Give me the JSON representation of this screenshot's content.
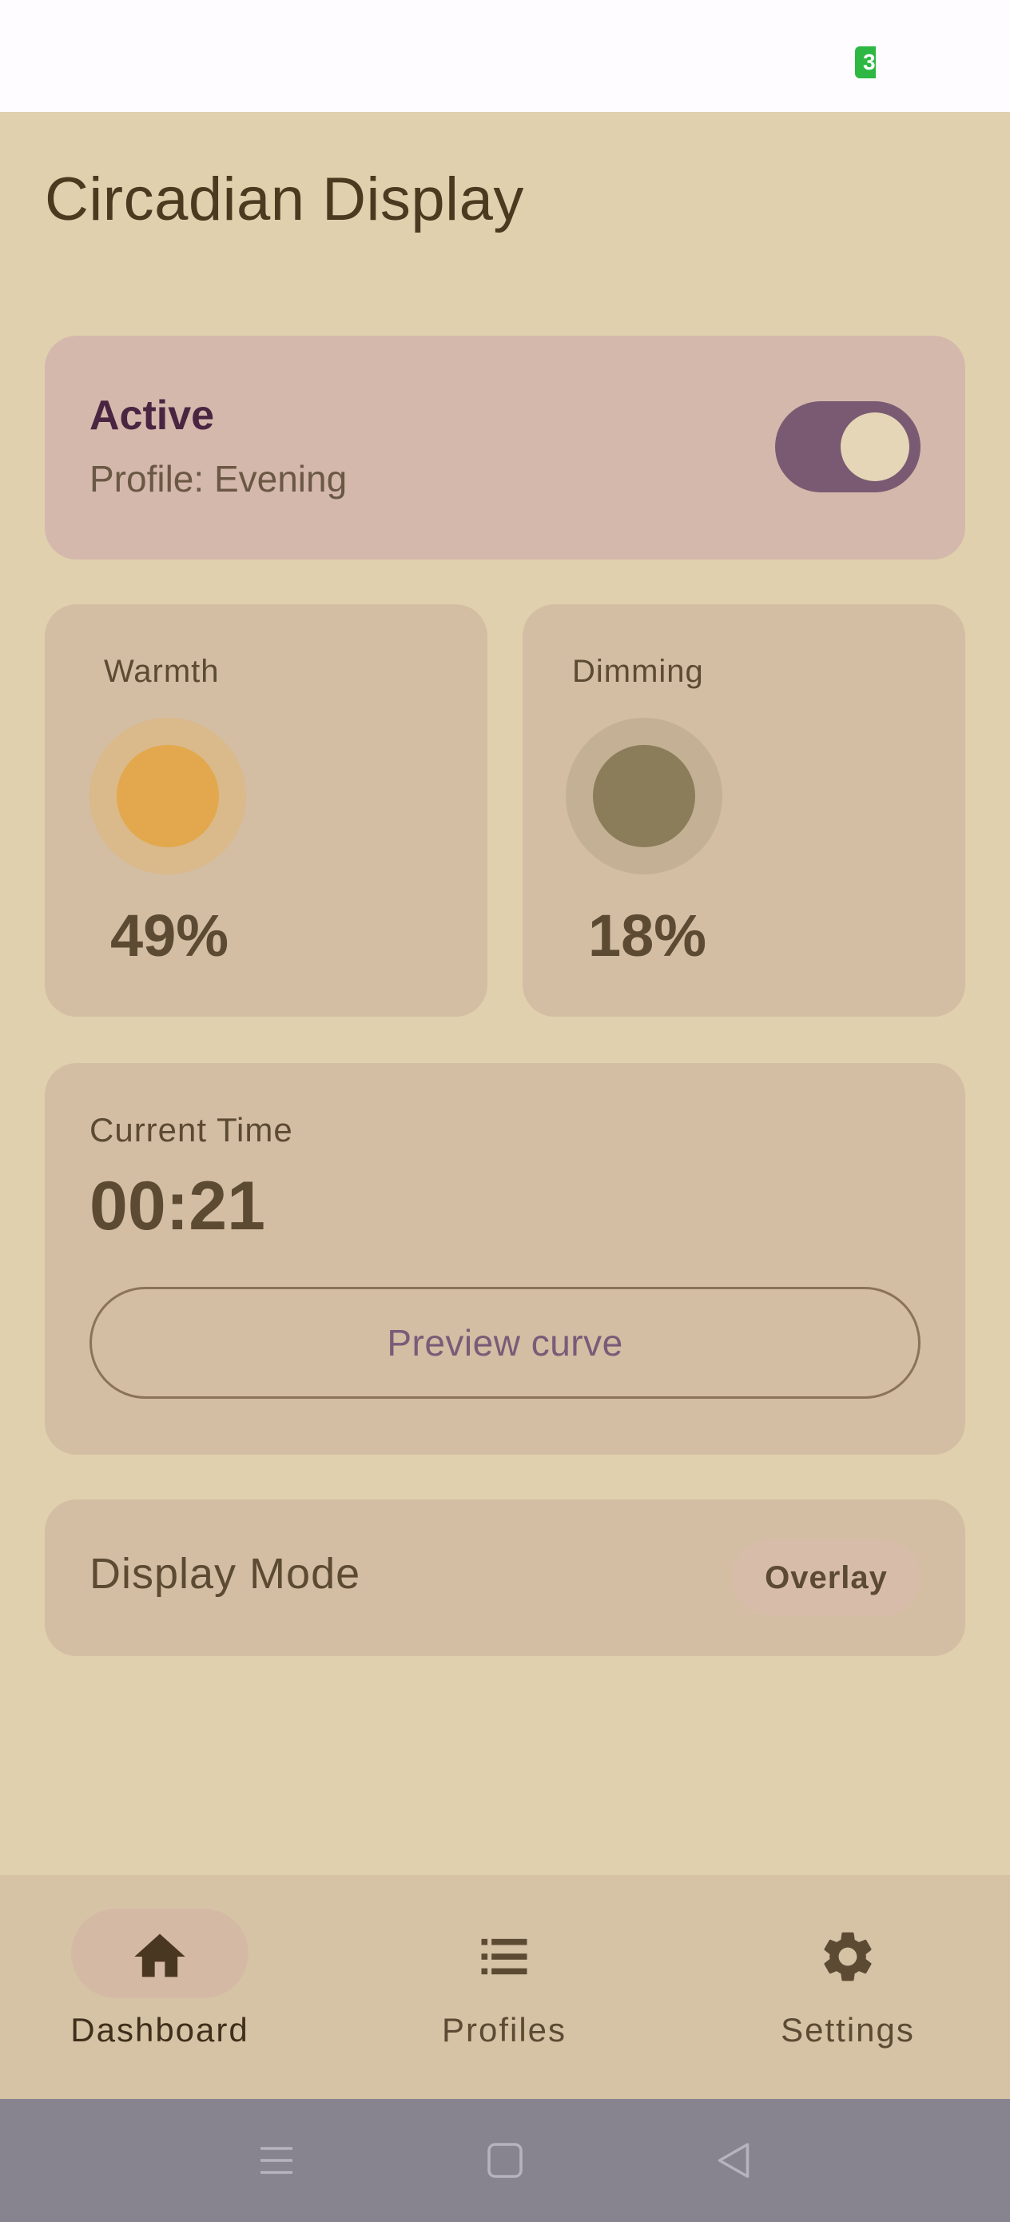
{
  "status_bar": {
    "battery_level": "3"
  },
  "header": {
    "title": "Circadian Display"
  },
  "active_card": {
    "title": "Active",
    "subtitle": "Profile: Evening",
    "toggle_on": true
  },
  "warmth": {
    "label": "Warmth",
    "value": "49%",
    "value_fraction": 0.49,
    "color": "#E3A84D"
  },
  "dimming": {
    "label": "Dimming",
    "value": "18%",
    "value_fraction": 0.18,
    "color": "#8B7D5A"
  },
  "time_card": {
    "label": "Current Time",
    "value": "00:21",
    "button_label": "Preview curve"
  },
  "display_mode": {
    "label": "Display Mode",
    "value": "Overlay"
  },
  "bottom_nav": {
    "items": [
      {
        "label": "Dashboard",
        "icon": "home-icon",
        "selected": true
      },
      {
        "label": "Profiles",
        "icon": "list-icon",
        "selected": false
      },
      {
        "label": "Settings",
        "icon": "gear-icon",
        "selected": false
      }
    ]
  },
  "system_nav": {
    "icons": [
      "menu-icon",
      "home-square-icon",
      "back-triangle-icon"
    ]
  },
  "colors": {
    "background": "#E0D0AE",
    "accent": "#7A5A72",
    "active_card": "#D4B8AC",
    "card": "#D3BEA3"
  }
}
